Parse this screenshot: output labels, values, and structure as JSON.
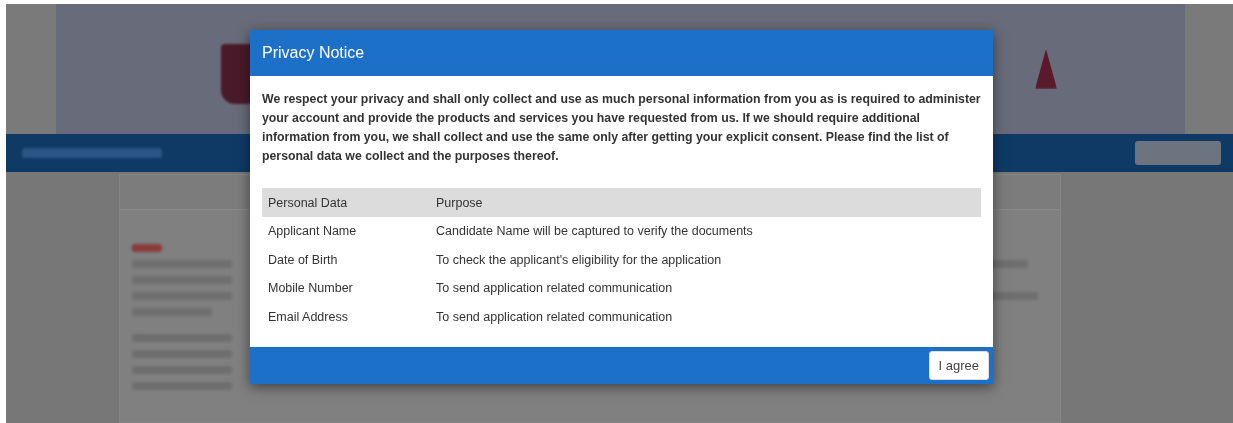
{
  "dialog": {
    "title": "Privacy Notice",
    "intro": "We respect your privacy and shall only collect and use as much personal information from you as is required to administer your account and provide the products and services you have requested from us. If we should require additional information from you, we shall collect and use the same only after getting your explicit consent. Please find the list of personal data we collect and the purposes thereof.",
    "table": {
      "columns": [
        "Personal Data",
        "Purpose"
      ],
      "rows": [
        [
          "Applicant Name",
          "Candidate Name will be captured to verify the documents"
        ],
        [
          "Date of Birth",
          "To check the applicant's eligibility for the application"
        ],
        [
          "Mobile Number",
          "To send application related communication"
        ],
        [
          "Email Address",
          "To send application related communication"
        ]
      ]
    },
    "buttons": [
      "I agree"
    ]
  }
}
